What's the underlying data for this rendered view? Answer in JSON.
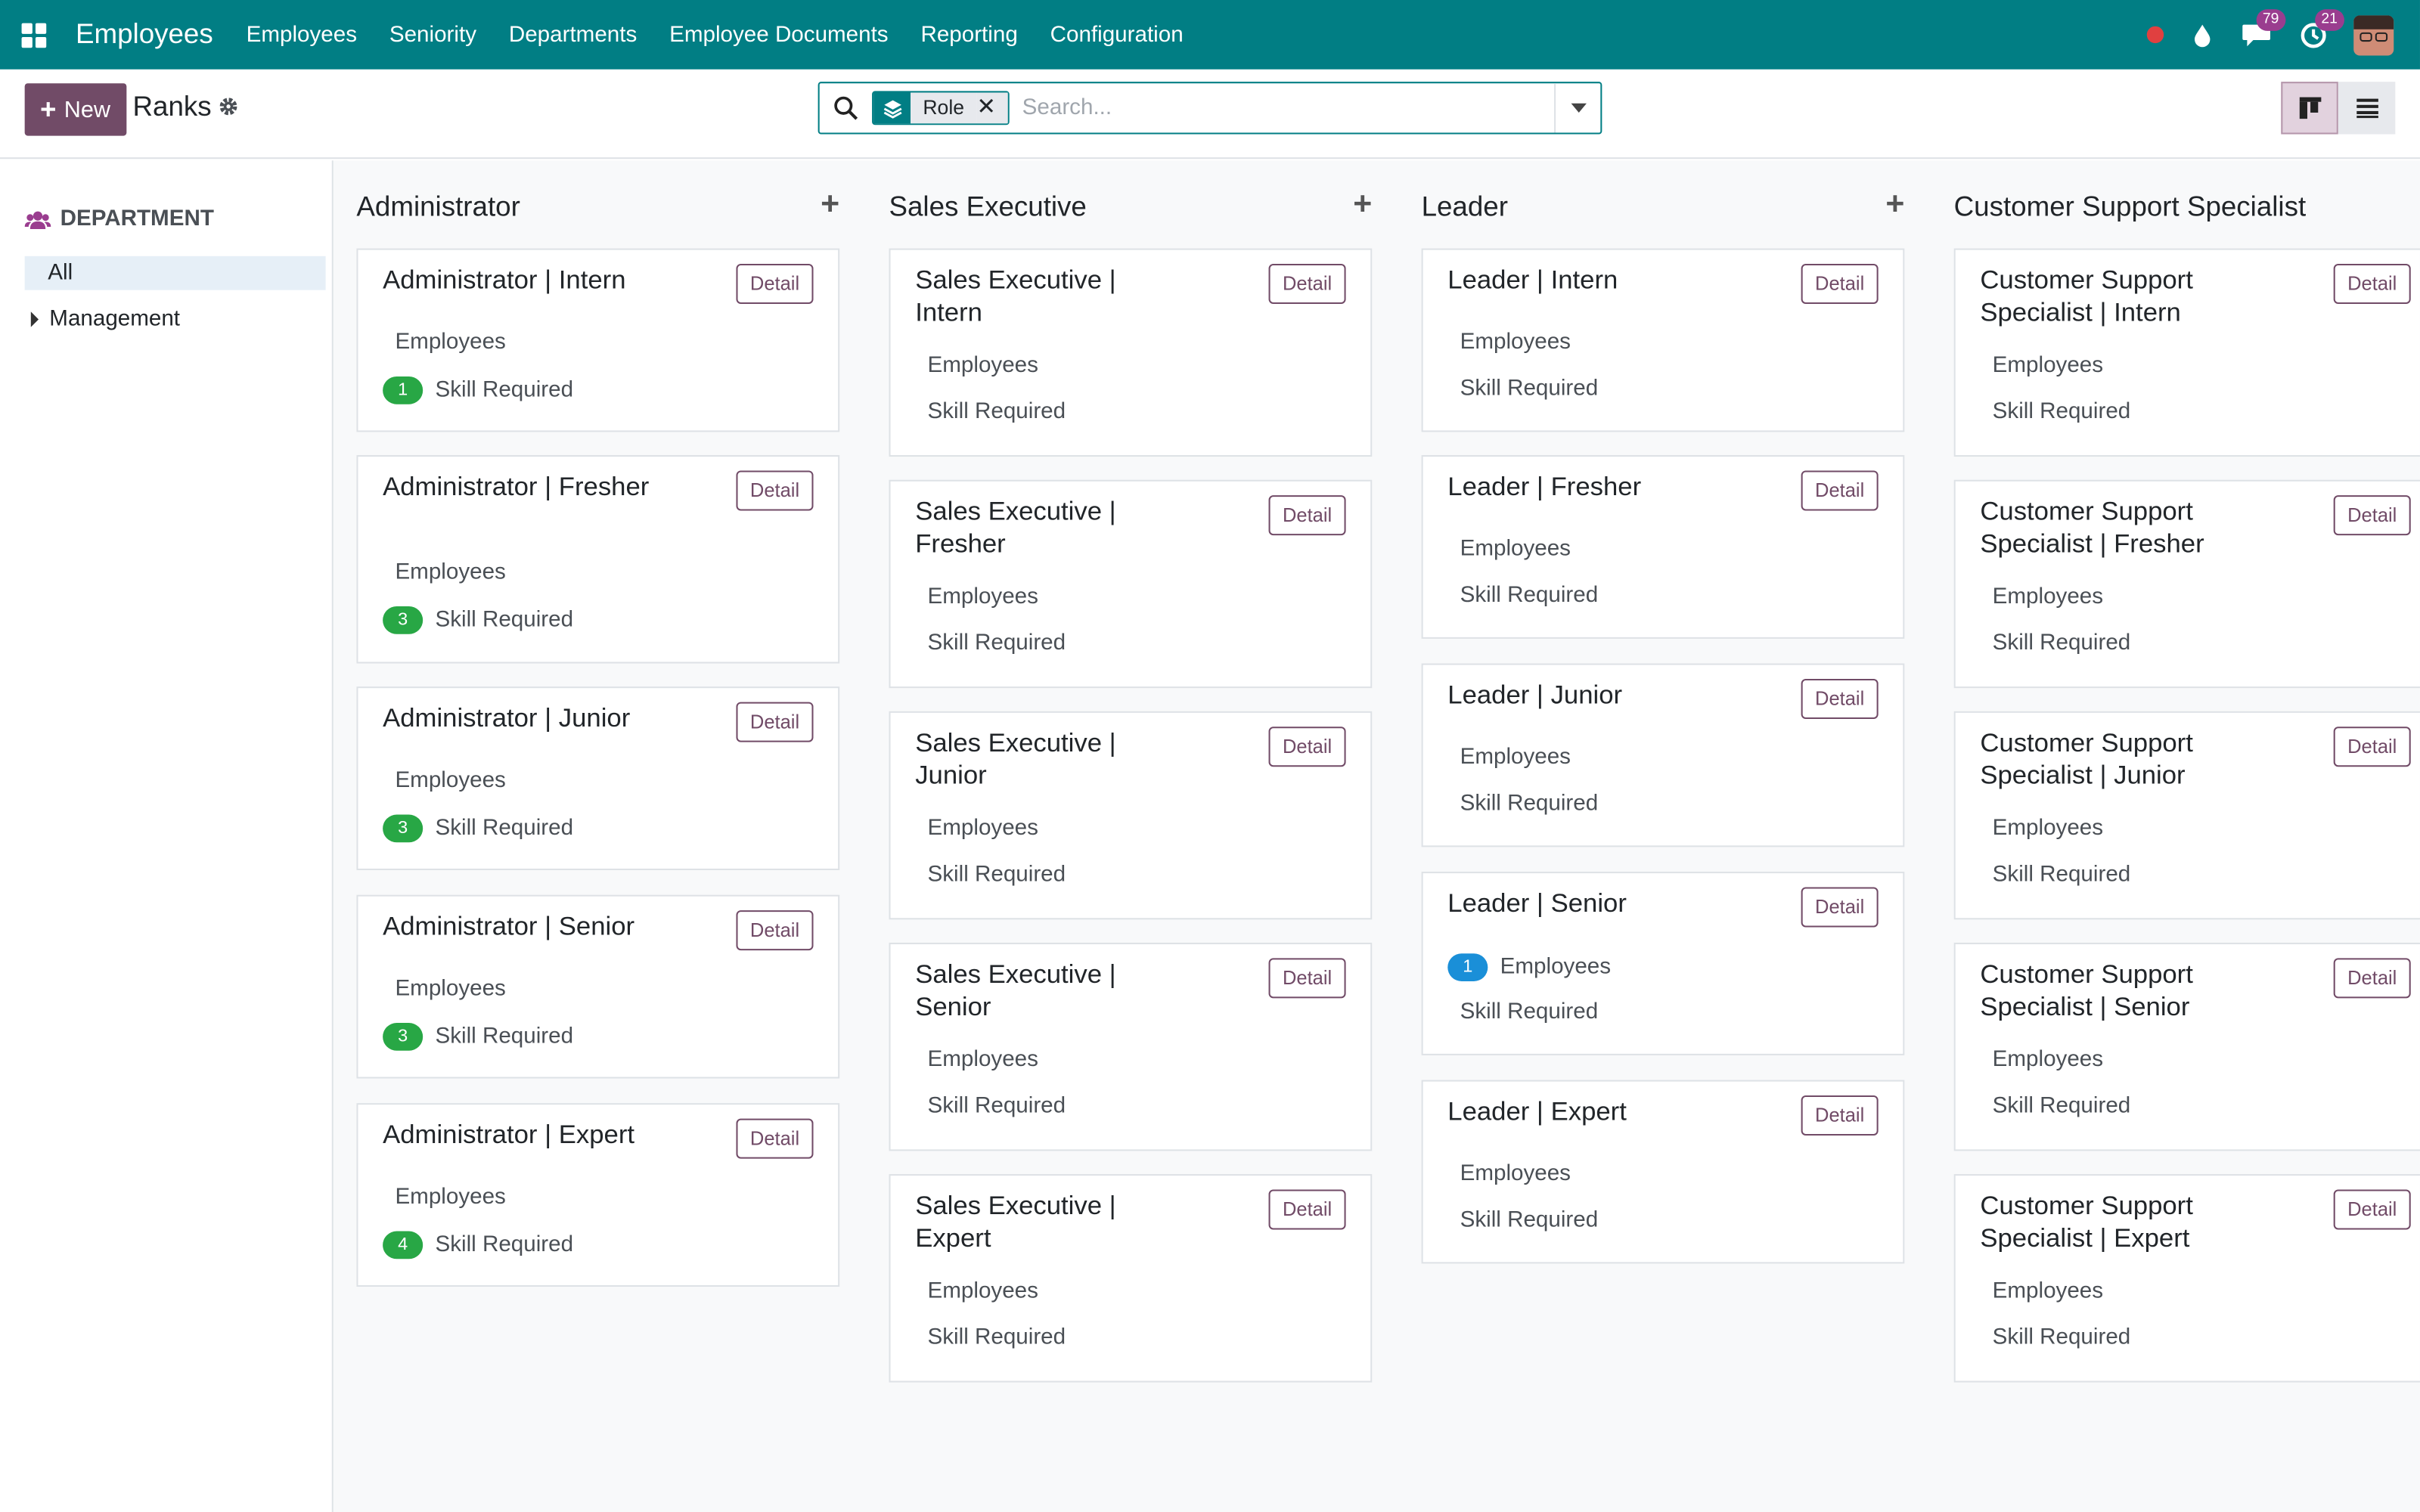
{
  "navbar": {
    "app_name": "Employees",
    "menu": [
      "Employees",
      "Seniority",
      "Departments",
      "Employee Documents",
      "Reporting",
      "Configuration"
    ],
    "messages_badge": "79",
    "activity_badge": "21",
    "accent_color": "#017e84",
    "icons": [
      "apps-grid-icon",
      "record-dot-icon",
      "droplet-icon",
      "chat-icon",
      "activity-clock-icon",
      "user-avatar"
    ]
  },
  "control": {
    "new_label": "New",
    "breadcrumb": "Ranks",
    "search": {
      "facet_label": "Role",
      "placeholder": "Search..."
    },
    "views": [
      "kanban-view",
      "list-view"
    ]
  },
  "sidepanel": {
    "header": "DEPARTMENT",
    "all_label": "All",
    "items": [
      "Management"
    ]
  },
  "kanban": {
    "detail_label": "Detail",
    "employees_label": "Employees",
    "skill_label": "Skill Required",
    "columns": [
      {
        "title": "Administrator",
        "cards": [
          {
            "title": "Administrator | Intern",
            "employees": null,
            "skills": "1"
          },
          {
            "title": "Administrator | Fresher",
            "employees": null,
            "skills": "3"
          },
          {
            "title": "Administrator | Junior",
            "employees": null,
            "skills": "3"
          },
          {
            "title": "Administrator | Senior",
            "employees": null,
            "skills": "3"
          },
          {
            "title": "Administrator | Expert",
            "employees": null,
            "skills": "4"
          }
        ]
      },
      {
        "title": "Sales Executive",
        "cards": [
          {
            "title": "Sales Executive | Intern",
            "employees": null,
            "skills": null
          },
          {
            "title": "Sales Executive | Fresher",
            "employees": null,
            "skills": null
          },
          {
            "title": "Sales Executive | Junior",
            "employees": null,
            "skills": null
          },
          {
            "title": "Sales Executive | Senior",
            "employees": null,
            "skills": null
          },
          {
            "title": "Sales Executive | Expert",
            "employees": null,
            "skills": null
          }
        ]
      },
      {
        "title": "Leader",
        "cards": [
          {
            "title": "Leader | Intern",
            "employees": null,
            "skills": null
          },
          {
            "title": "Leader | Fresher",
            "employees": null,
            "skills": null
          },
          {
            "title": "Leader | Junior",
            "employees": null,
            "skills": null
          },
          {
            "title": "Leader | Senior",
            "employees": "1",
            "skills": null
          },
          {
            "title": "Leader | Expert",
            "employees": null,
            "skills": null
          }
        ]
      },
      {
        "title": "Customer Support Specialist",
        "cards": [
          {
            "title": "Customer Support Specialist | Intern",
            "employees": null,
            "skills": null
          },
          {
            "title": "Customer Support Specialist | Fresher",
            "employees": null,
            "skills": null
          },
          {
            "title": "Customer Support Specialist | Junior",
            "employees": null,
            "skills": null
          },
          {
            "title": "Customer Support Specialist | Senior",
            "employees": null,
            "skills": null
          },
          {
            "title": "Customer Support Specialist | Expert",
            "employees": null,
            "skills": null
          }
        ]
      }
    ]
  }
}
